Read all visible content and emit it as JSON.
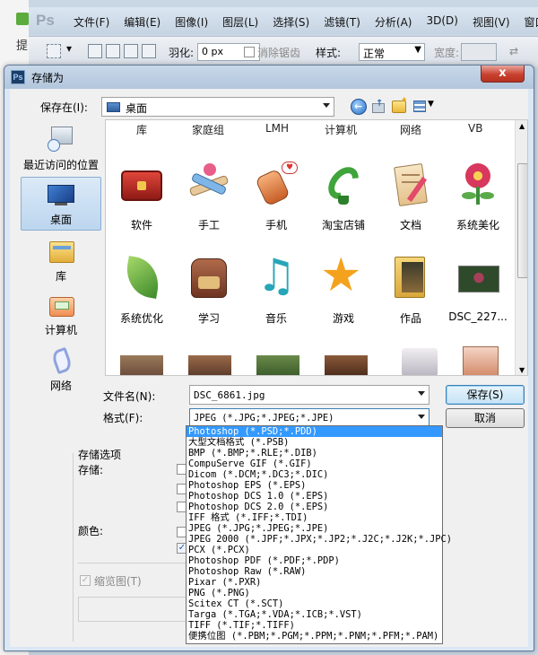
{
  "bg": {
    "left_strip": "提",
    "logo": "Ps",
    "menus": [
      "文件(F)",
      "编辑(E)",
      "图像(I)",
      "图层(L)",
      "选择(S)",
      "滤镜(T)",
      "分析(A)",
      "3D(D)",
      "视图(V)",
      "窗口"
    ],
    "options": {
      "feather_label": "羽化:",
      "feather_value": "0 px",
      "antialias": "消除锯齿",
      "style_label": "样式:",
      "style_value": "正常",
      "width_label": "宽度:"
    }
  },
  "dialog": {
    "title": "存储为",
    "close": "x",
    "save_in_label": "保存在(I):",
    "save_in_value": "桌面",
    "places": [
      {
        "label": "最近访问的位置",
        "icon": "recent-places-icon"
      },
      {
        "label": "桌面",
        "icon": "desktop-icon",
        "selected": true
      },
      {
        "label": "库",
        "icon": "libraries-icon"
      },
      {
        "label": "计算机",
        "icon": "computer-icon"
      },
      {
        "label": "网络",
        "icon": "network-icon"
      }
    ],
    "top_row": [
      "库",
      "家庭组",
      "LMH",
      "计算机",
      "网络",
      "VB"
    ],
    "items": [
      {
        "label": "软件",
        "icon": "red-chest-icon"
      },
      {
        "label": "手工",
        "icon": "crafts-icon"
      },
      {
        "label": "手机",
        "icon": "mobile-phone-icon"
      },
      {
        "label": "淘宝店铺",
        "icon": "green-plant-icon"
      },
      {
        "label": "文档",
        "icon": "document-icon"
      },
      {
        "label": "系统美化",
        "icon": "flower-icon"
      },
      {
        "label": "系统优化",
        "icon": "leaf-icon"
      },
      {
        "label": "学习",
        "icon": "backpack-icon"
      },
      {
        "label": "音乐",
        "icon": "music-note-icon"
      },
      {
        "label": "游戏",
        "icon": "star-icon"
      },
      {
        "label": "作品",
        "icon": "image-folder-icon"
      },
      {
        "label": "DSC_227...",
        "icon": "photo-thumbnail-icon"
      }
    ],
    "filename_label": "文件名(N):",
    "filename_value": "DSC_6861.jpg",
    "format_label": "格式(F):",
    "format_value": "JPEG (*.JPG;*.JPEG;*.JPE)",
    "save_button": "保存(S)",
    "cancel_button": "取消",
    "save_options_label": "存储选项",
    "store_label": "存储:",
    "color_label": "颜色:",
    "thumbnail_label": "缩览图(T)",
    "formats": [
      "Photoshop (*.PSD;*.PDD)",
      "大型文档格式 (*.PSB)",
      "BMP (*.BMP;*.RLE;*.DIB)",
      "CompuServe GIF (*.GIF)",
      "Dicom (*.DCM;*.DC3;*.DIC)",
      "Photoshop EPS (*.EPS)",
      "Photoshop DCS 1.0 (*.EPS)",
      "Photoshop DCS 2.0 (*.EPS)",
      "IFF 格式 (*.IFF;*.TDI)",
      "JPEG (*.JPG;*.JPEG;*.JPE)",
      "JPEG 2000 (*.JPF;*.JPX;*.JP2;*.J2C;*.J2K;*.JPC)",
      "PCX (*.PCX)",
      "Photoshop PDF (*.PDF;*.PDP)",
      "Photoshop Raw (*.RAW)",
      "Pixar (*.PXR)",
      "PNG (*.PNG)",
      "Scitex CT (*.SCT)",
      "Targa (*.TGA;*.VDA;*.ICB;*.VST)",
      "TIFF (*.TIF;*.TIFF)",
      "便携位图 (*.PBM;*.PGM;*.PPM;*.PNM;*.PFM;*.PAM)"
    ],
    "highlighted_format": "Photoshop (*.PSD;*.PDD)"
  }
}
